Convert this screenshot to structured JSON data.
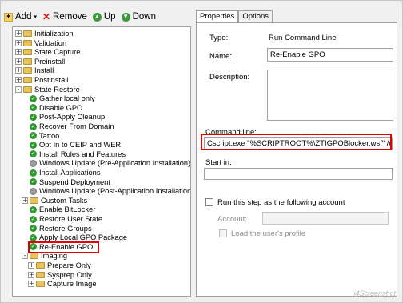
{
  "toolbar": {
    "add_label": "Add",
    "remove_label": "Remove",
    "up_label": "Up",
    "down_label": "Down"
  },
  "tree": {
    "items": [
      {
        "label": "Initialization",
        "kind": "folder",
        "expander": "+",
        "depth": 0
      },
      {
        "label": "Validation",
        "kind": "folder",
        "expander": "+",
        "depth": 0
      },
      {
        "label": "State Capture",
        "kind": "folder",
        "expander": "+",
        "depth": 0
      },
      {
        "label": "Preinstall",
        "kind": "folder",
        "expander": "+",
        "depth": 0
      },
      {
        "label": "Install",
        "kind": "folder",
        "expander": "+",
        "depth": 0
      },
      {
        "label": "Postinstall",
        "kind": "folder",
        "expander": "+",
        "depth": 0
      },
      {
        "label": "State Restore",
        "kind": "folder",
        "expander": "-",
        "depth": 0
      },
      {
        "label": "Gather local only",
        "kind": "step",
        "depth": 1
      },
      {
        "label": "Disable GPO",
        "kind": "step",
        "depth": 1
      },
      {
        "label": "Post-Apply Cleanup",
        "kind": "step",
        "depth": 1
      },
      {
        "label": "Recover From Domain",
        "kind": "step",
        "depth": 1
      },
      {
        "label": "Tattoo",
        "kind": "step",
        "depth": 1
      },
      {
        "label": "Opt In to CEIP and WER",
        "kind": "step",
        "depth": 1
      },
      {
        "label": "Install Roles and Features",
        "kind": "step",
        "depth": 1
      },
      {
        "label": "Windows Update (Pre-Application Installation)",
        "kind": "gear",
        "depth": 1
      },
      {
        "label": "Install Applications",
        "kind": "step",
        "depth": 1
      },
      {
        "label": "Suspend Deployment",
        "kind": "step",
        "depth": 1
      },
      {
        "label": "Windows Update (Post-Application Installation)",
        "kind": "gear",
        "depth": 1
      },
      {
        "label": "Custom Tasks",
        "kind": "folder",
        "expander": "+",
        "depth": 1
      },
      {
        "label": "Enable BitLocker",
        "kind": "step",
        "depth": 1
      },
      {
        "label": "Restore User State",
        "kind": "step",
        "depth": 1
      },
      {
        "label": "Restore Groups",
        "kind": "step",
        "depth": 1
      },
      {
        "label": "Apply Local GPO Package",
        "kind": "step",
        "depth": 1
      },
      {
        "label": "Re-Enable GPO",
        "kind": "step",
        "depth": 1
      },
      {
        "label": "Imaging",
        "kind": "folder",
        "expander": "-",
        "depth": 1
      },
      {
        "label": "Prepare Only",
        "kind": "folder",
        "expander": "+",
        "depth": 2
      },
      {
        "label": "Sysprep Only",
        "kind": "folder",
        "expander": "+",
        "depth": 2
      },
      {
        "label": "Capture Image",
        "kind": "folder",
        "expander": "+",
        "depth": 2
      }
    ]
  },
  "tabs": [
    {
      "label": "Properties"
    },
    {
      "label": "Options"
    }
  ],
  "props": {
    "type_label": "Type:",
    "type_value": "Run Command Line",
    "name_label": "Name:",
    "name_value": "Re-Enable GPO",
    "desc_label": "Description:",
    "cmd_label": "Command line:",
    "cmd_value": "Cscript.exe \"%SCRIPTROOT%\\ZTIGPOBlocker.wsf\" /off",
    "startin_label": "Start in:",
    "runas_label": "Run this step as the following account",
    "account_label": "Account:",
    "loadprofile_label": "Load the user's profile"
  },
  "watermark": "j4Screenshot",
  "colors": {
    "highlight": "#e00000",
    "step_ok": "#2f9b2f",
    "folder": "#e8c25a"
  }
}
